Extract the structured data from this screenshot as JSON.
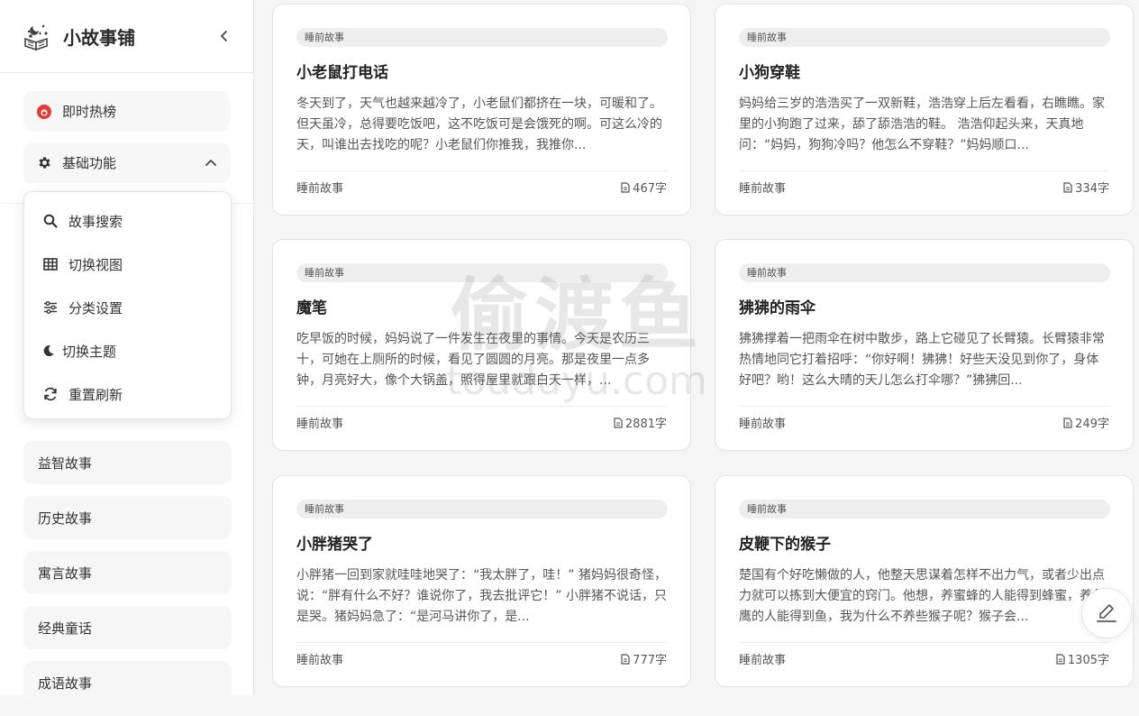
{
  "brand": {
    "title": "小故事铺"
  },
  "nav": {
    "hot": {
      "label": "即时热榜",
      "icon": "fire-icon",
      "color": "#e53935"
    },
    "basic": {
      "label": "基础功能",
      "icon": "gear-icon"
    }
  },
  "dropdown": {
    "items": [
      {
        "label": "故事搜索",
        "icon": "search-icon"
      },
      {
        "label": "切换视图",
        "icon": "grid-icon"
      },
      {
        "label": "分类设置",
        "icon": "sliders-icon"
      },
      {
        "label": "切换主题",
        "icon": "moon-icon"
      },
      {
        "label": "重置刷新",
        "icon": "refresh-icon"
      }
    ]
  },
  "categories": [
    "益智故事",
    "历史故事",
    "寓言故事",
    "经典童话",
    "成语故事"
  ],
  "cards": [
    {
      "tag": "睡前故事",
      "title": "小老鼠打电话",
      "excerpt": "冬天到了，天气也越来越冷了，小老鼠们都挤在一块，可暖和了。但天虽冷，总得要吃饭吧，这不吃饭可是会饿死的啊。可这么冷的天，叫谁出去找吃的呢？小老鼠们你推我，我推你...",
      "category": "睡前故事",
      "count": "467字"
    },
    {
      "tag": "睡前故事",
      "title": "小狗穿鞋",
      "excerpt": "妈妈给三岁的浩浩买了一双新鞋，浩浩穿上后左看看，右瞧瞧。家里的小狗跑了过来，舔了舔浩浩的鞋。 浩浩仰起头来，天真地问：“妈妈，狗狗冷吗？他怎么不穿鞋？”妈妈顺口...",
      "category": "睡前故事",
      "count": "334字"
    },
    {
      "tag": "睡前故事",
      "title": "魔笔",
      "excerpt": "吃早饭的时候，妈妈说了一件发生在夜里的事情。今天是农历三十，可她在上厕所的时候，看见了圆圆的月亮。那是夜里一点多钟，月亮好大，像个大锅盖，照得屋里就跟白天一样，...",
      "category": "睡前故事",
      "count": "2881字"
    },
    {
      "tag": "睡前故事",
      "title": "狒狒的雨伞",
      "excerpt": "狒狒撑着一把雨伞在树中散步，路上它碰见了长臂猿。长臂猿非常热情地同它打着招呼：“你好啊！狒狒！好些天没见到你了，身体好吧？哟！这么大晴的天儿怎么打伞哪？”狒狒回...",
      "category": "睡前故事",
      "count": "249字"
    },
    {
      "tag": "睡前故事",
      "title": "小胖猪哭了",
      "excerpt": "小胖猪一回到家就哇哇地哭了：“我太胖了，哇！” 猪妈妈很奇怪，说：“胖有什么不好？谁说你了，我去批评它！” 小胖猪不说话，只是哭。猪妈妈急了：“是河马讲你了，是...",
      "category": "睡前故事",
      "count": "777字"
    },
    {
      "tag": "睡前故事",
      "title": "皮鞭下的猴子",
      "excerpt": "楚国有个好吃懒做的人，他整天思谋着怎样不出力气，或者少出点力就可以拣到大便宜的窍门。他想，养蜜蜂的人能得到蜂蜜，养鱼鹰的人能得到鱼，我为什么不养些猴子呢？猴子会...",
      "category": "睡前故事",
      "count": "1305字"
    }
  ],
  "watermark": {
    "line1": "偷渡鱼",
    "line2": "touduyu.com"
  },
  "fab": {
    "icon": "pen-icon"
  }
}
